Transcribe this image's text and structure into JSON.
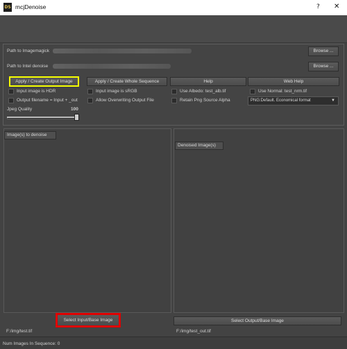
{
  "window": {
    "title": "mcjDenoise",
    "logo_text": "DS",
    "help_glyph": "?",
    "close_glyph": "✕"
  },
  "paths": {
    "imagemagick_label": "Path to Imagemagick",
    "intel_label": "Path to Intel denoise",
    "browse_label": "Browse ..."
  },
  "actions": {
    "apply_output": "Apply / Create Output Image",
    "apply_sequence": "Apply / Create Whole Sequence",
    "help": "Help",
    "web_help": "Web Help"
  },
  "options": {
    "input_hdr": "Input image is HDR",
    "input_srgb": "Input image is sRGB",
    "use_albedo": "Use Albedo: test_alb.tif",
    "use_normal": "Use Normal: test_nrm.tif",
    "output_filename": "Output filename = Input + _out",
    "allow_overwrite": "Allow Overwriting Output File",
    "retain_alpha": "Retain Png Source Alpha",
    "png_format": "PNG:Default. Economical format",
    "jpeg_quality_label": "Jpeg Quality",
    "jpeg_quality_value": "100",
    "jpeg_quality_fraction": 1.0
  },
  "left_pane": {
    "header": "Image(s) to denoise",
    "select_button": "Select Input/Base Image",
    "path": "F:/img/test.tif"
  },
  "right_pane": {
    "header": "Denoised Image(s)",
    "select_button": "Select Output/Base Image",
    "path": "F:/img/test_out.tif"
  },
  "status": {
    "text": "Num Images In Sequence: 0"
  },
  "colors": {
    "highlight_yellow": "#f6ff00",
    "highlight_red": "#e00000"
  }
}
